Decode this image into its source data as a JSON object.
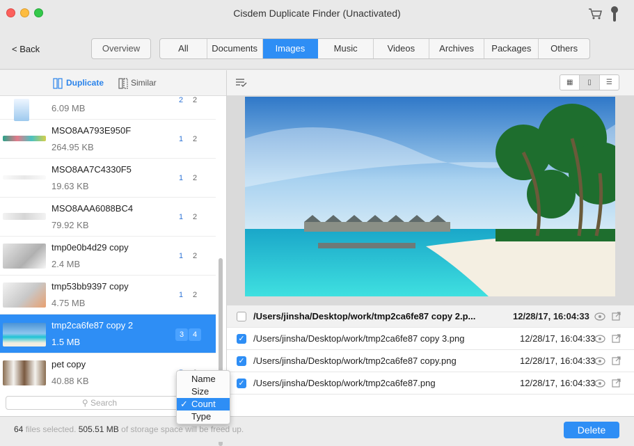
{
  "window": {
    "title": "Cisdem Duplicate Finder (Unactivated)"
  },
  "toolbar": {
    "back": "< Back",
    "overview": "Overview",
    "tabs": [
      "All",
      "Documents",
      "Images",
      "Music",
      "Videos",
      "Archives",
      "Packages",
      "Others"
    ],
    "selected_tab": "Images"
  },
  "mode": {
    "duplicate": "Duplicate",
    "similar": "Similar"
  },
  "items": [
    {
      "name": "",
      "size": "6.09 MB",
      "c1": "2",
      "c2": "2"
    },
    {
      "name": "MSO8AA793E950F",
      "size": "264.95 KB",
      "c1": "1",
      "c2": "2"
    },
    {
      "name": "MSO8AA7C4330F5",
      "size": "19.63 KB",
      "c1": "1",
      "c2": "2"
    },
    {
      "name": "MSO8AAA6088BC4",
      "size": "79.92 KB",
      "c1": "1",
      "c2": "2"
    },
    {
      "name": "tmp0e0b4d29 copy",
      "size": "2.4 MB",
      "c1": "1",
      "c2": "2"
    },
    {
      "name": "tmp53bb9397 copy",
      "size": "4.75 MB",
      "c1": "1",
      "c2": "2"
    },
    {
      "name": "tmp2ca6fe87 copy 2",
      "size": "1.5 MB",
      "c1": "3",
      "c2": "4"
    },
    {
      "name": "pet copy",
      "size": "40.88 KB",
      "c1": "5",
      "c2": "6"
    }
  ],
  "search": {
    "placeholder": "Search"
  },
  "sort_menu": {
    "items": [
      "Name",
      "Size",
      "Count",
      "Type"
    ],
    "checked": "Count"
  },
  "files": [
    {
      "path": "/Users/jinsha/Desktop/work/tmp2ca6fe87 copy 2.p...",
      "date": "12/28/17, 16:04:33",
      "checked": false
    },
    {
      "path": "/Users/jinsha/Desktop/work/tmp2ca6fe87 copy 3.png",
      "date": "12/28/17, 16:04:33",
      "checked": true
    },
    {
      "path": "/Users/jinsha/Desktop/work/tmp2ca6fe87 copy.png",
      "date": "12/28/17, 16:04:33",
      "checked": true
    },
    {
      "path": "/Users/jinsha/Desktop/work/tmp2ca6fe87.png",
      "date": "12/28/17, 16:04:33",
      "checked": true
    }
  ],
  "status": {
    "count": "64",
    "count_label": "files selected.",
    "size": "505.51 MB",
    "size_label": "of storage space will be freed up.",
    "delete": "Delete"
  },
  "colors": {
    "accent": "#2e8ef5"
  }
}
